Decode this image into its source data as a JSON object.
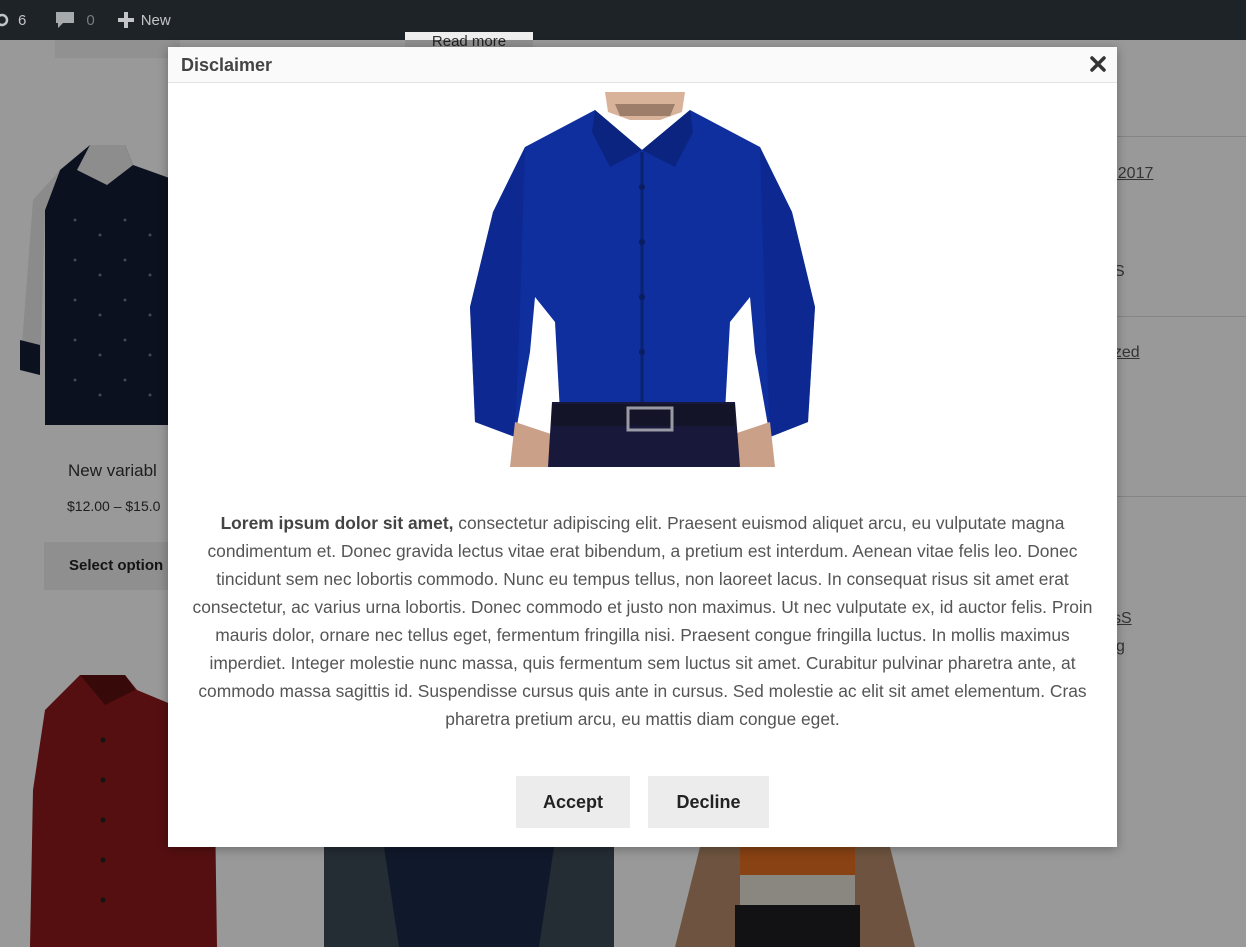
{
  "admin_bar": {
    "updates_count": "6",
    "comments_count": "0",
    "new_label": "New"
  },
  "background": {
    "read_more_label": "Read more",
    "product_title": "New variabl",
    "product_price": "$12.00 – $15.0",
    "select_options_label": "Select option",
    "sidebar": {
      "link_1": "r 2017",
      "text_1": "S",
      "link_2": "rized",
      "link_3": "sS",
      "text_2": "g"
    }
  },
  "modal": {
    "title": "Disclaimer",
    "close_icon": "close-icon",
    "body_bold": "Lorem ipsum dolor sit amet,",
    "body_text": " consectetur adipiscing elit. Praesent euismod aliquet arcu, eu vulputate magna condimentum et. Donec gravida lectus vitae erat bibendum, a pretium est interdum. Aenean vitae felis leo. Donec tincidunt sem nec lobortis commodo. Nunc eu tempus tellus, non laoreet lacus. In consequat risus sit amet erat consectetur, ac varius urna lobortis. Donec commodo et justo non maximus. Ut nec vulputate ex, id auctor felis. Proin mauris dolor, ornare nec tellus eget, fermentum fringilla nisi. Praesent congue fringilla luctus. In mollis maximus imperdiet. Integer molestie nunc massa, quis fermentum sem luctus sit amet. Curabitur pulvinar pharetra ante, at commodo massa sagittis id. Suspendisse cursus quis ante in cursus. Sed molestie ac elit sit amet elementum. Cras pharetra pretium arcu, eu mattis diam congue eget.",
    "accept_label": "Accept",
    "decline_label": "Decline"
  },
  "colors": {
    "admin_bar": "#1d2327",
    "shirt_blue": "#0f2f9e",
    "button_bg": "#ececec"
  }
}
